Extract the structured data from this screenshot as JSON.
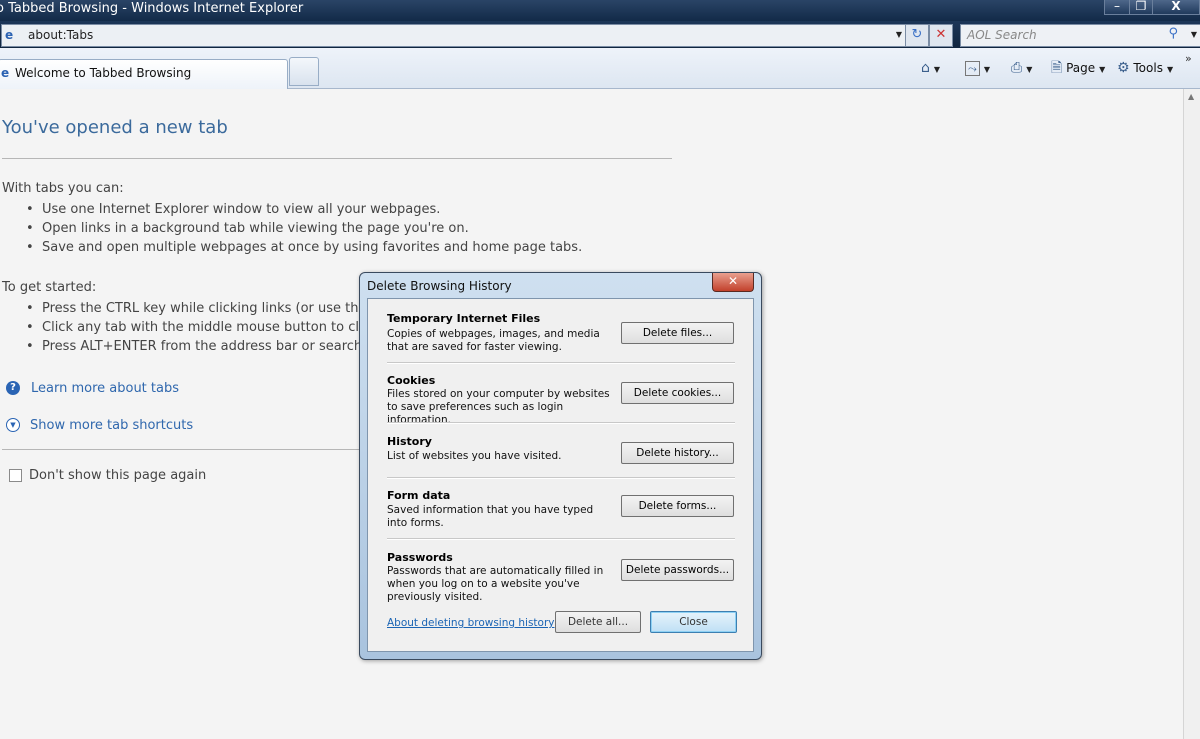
{
  "window": {
    "title": "o Tabbed Browsing - Windows Internet Explorer",
    "minimize": "–",
    "maximize": "❐",
    "close": "X"
  },
  "address_bar": {
    "url": "about:Tabs"
  },
  "search": {
    "placeholder": "AOL Search"
  },
  "tabs": [
    {
      "label": "Welcome to Tabbed Browsing",
      "active": true
    }
  ],
  "commands": {
    "page": "Page",
    "tools": "Tools"
  },
  "page": {
    "title": "You've opened a new tab",
    "with_tabs_heading": "With tabs you can:",
    "with_tabs_items": [
      "Use one Internet Explorer window to view all your webpages.",
      "Open links in a background tab while viewing the page you're on.",
      "Save and open multiple webpages at once by using favorites and home page tabs."
    ],
    "get_started_heading": "To get started:",
    "get_started_items": [
      "Press the CTRL key while clicking links (or use the m",
      "Click any tab with the middle mouse button to close",
      "Press ALT+ENTER from the address bar or search bo"
    ],
    "learn_more": "Learn more about tabs",
    "show_shortcuts": "Show more tab shortcuts",
    "dont_show": "Don't show this page again"
  },
  "dialog": {
    "title": "Delete Browsing History",
    "sections": [
      {
        "heading": "Temporary Internet Files",
        "description": "Copies of webpages, images, and media that are saved for faster viewing.",
        "button": "Delete files..."
      },
      {
        "heading": "Cookies",
        "description": "Files stored on your computer by websites to save preferences such as login information.",
        "button": "Delete cookies..."
      },
      {
        "heading": "History",
        "description": "List of websites you have visited.",
        "button": "Delete history..."
      },
      {
        "heading": "Form data",
        "description": "Saved information that you have typed into forms.",
        "button": "Delete forms..."
      },
      {
        "heading": "Passwords",
        "description": "Passwords that are automatically filled in when you log on to a website you've previously visited.",
        "button": "Delete passwords..."
      }
    ],
    "about_link": "About deleting browsing history",
    "delete_all": "Delete all...",
    "close": "Close"
  },
  "colors": {
    "link": "#2f67ad",
    "title_bar": "#122a48",
    "page_title": "#3b6a9c"
  }
}
